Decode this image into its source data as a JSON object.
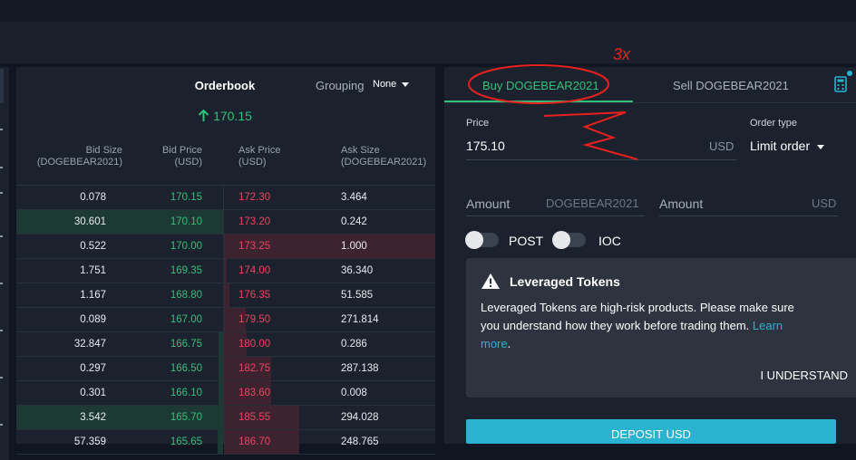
{
  "orderbook": {
    "title": "Orderbook",
    "grouping_label": "Grouping",
    "grouping_value": "None",
    "last_price": "170.15",
    "headers": {
      "bid_size": [
        "Bid Size",
        "(DOGEBEAR2021)"
      ],
      "bid_price": [
        "Bid Price",
        "(USD)"
      ],
      "ask_price": [
        "Ask Price",
        "(USD)"
      ],
      "ask_size": [
        "Ask Size",
        "(DOGEBEAR2021)"
      ]
    },
    "rows": [
      {
        "bid_size": "0.078",
        "bid_price": "170.15",
        "ask_price": "172.30",
        "ask_size": "3.464"
      },
      {
        "bid_size": "30.601",
        "bid_price": "170.10",
        "ask_price": "173.20",
        "ask_size": "0.242"
      },
      {
        "bid_size": "0.522",
        "bid_price": "170.00",
        "ask_price": "173.25",
        "ask_size": "1.000"
      },
      {
        "bid_size": "1.751",
        "bid_price": "169.35",
        "ask_price": "174.00",
        "ask_size": "36.340"
      },
      {
        "bid_size": "1.167",
        "bid_price": "168.80",
        "ask_price": "176.35",
        "ask_size": "51.585"
      },
      {
        "bid_size": "0.089",
        "bid_price": "167.00",
        "ask_price": "179.50",
        "ask_size": "271.814"
      },
      {
        "bid_size": "32.847",
        "bid_price": "166.75",
        "ask_price": "180.00",
        "ask_size": "0.286"
      },
      {
        "bid_size": "0.297",
        "bid_price": "166.50",
        "ask_price": "182.75",
        "ask_size": "287.138"
      },
      {
        "bid_size": "0.301",
        "bid_price": "166.10",
        "ask_price": "183.60",
        "ask_size": "0.008"
      },
      {
        "bid_size": "3.542",
        "bid_price": "165.70",
        "ask_price": "185.55",
        "ask_size": "294.028"
      },
      {
        "bid_size": "57.359",
        "bid_price": "165.65",
        "ask_price": "186.70",
        "ask_size": "248.765"
      }
    ]
  },
  "order_form": {
    "tab_buy": "Buy DOGEBEAR2021",
    "tab_sell": "Sell DOGEBEAR2021",
    "price_label": "Price",
    "price_value": "175.10",
    "price_unit": "USD",
    "order_type_label": "Order type",
    "order_type_value": "Limit order",
    "amount_label": "Amount",
    "amount_unit_token": "DOGEBEAR2021",
    "amount_unit_usd": "USD",
    "post_label": "POST",
    "ioc_label": "IOC",
    "warning_title": "Leveraged Tokens",
    "warning_text": "Leveraged Tokens are high-risk products. Please make sure you understand how they work before trading them. ",
    "learn_more": "Learn more",
    "understand_label": "I UNDERSTAND",
    "deposit_label": "DEPOSIT USD"
  },
  "annotation_text": "3x",
  "colors": {
    "bid": "#30c07a",
    "ask": "#e5475f",
    "accent": "#2ab3d1",
    "annotation": "#e8201e"
  },
  "icons": [
    "arrow-up-icon",
    "caret-down-icon",
    "calculator-icon",
    "warning-triangle-icon"
  ]
}
